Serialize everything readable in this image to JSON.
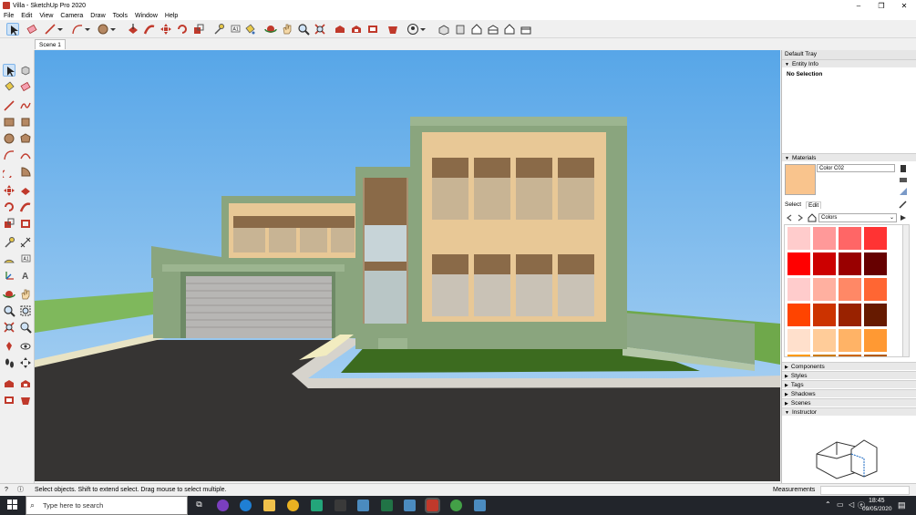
{
  "window": {
    "title": "Villa - SketchUp Pro 2020",
    "minimize": "–",
    "maximize": "❐",
    "close": "✕"
  },
  "menu": [
    "File",
    "Edit",
    "View",
    "Camera",
    "Draw",
    "Tools",
    "Window",
    "Help"
  ],
  "scene_tab": "Scene 1",
  "toolbar_icons": [
    "select-icon",
    "eraser-icon",
    "line-icon",
    "line-dropdown-icon",
    "arc-icon",
    "arc-dropdown-icon",
    "shape-icon",
    "shape-dropdown-icon",
    "push-pull-icon",
    "follow-me-icon",
    "move-icon",
    "rotate-icon",
    "scale-icon",
    "tape-measure-icon",
    "text-icon",
    "paint-bucket-icon",
    "orbit-icon",
    "pan-icon",
    "zoom-icon",
    "zoom-extents-icon",
    "warehouse-icon",
    "extension-warehouse-icon",
    "layout-icon",
    "extension-manager-icon",
    "account-icon",
    "iso-view-icon",
    "top-view-icon",
    "front-view-icon",
    "right-view-icon",
    "back-view-icon",
    "left-view-icon"
  ],
  "tray": {
    "title": "Default Tray",
    "entity_info": {
      "label": "Entity Info",
      "selection": "No Selection"
    },
    "materials": {
      "label": "Materials",
      "current_name": "Color C02",
      "current_color": "#f9c48d",
      "tab_select": "Select",
      "tab_edit": "Edit",
      "library": "Colors",
      "swatches": [
        "#ffcccc",
        "#ff9999",
        "#ff6666",
        "#ff3333",
        "#ff0000",
        "#cc0000",
        "#990000",
        "#660000",
        "#ffcccc",
        "#ffb0a0",
        "#ff8866",
        "#ff6633",
        "#ff4400",
        "#cc3300",
        "#992200",
        "#661a00",
        "#ffe0cc",
        "#ffcc99",
        "#ffb366",
        "#ff9933",
        "#ff9900",
        "#cc7a00",
        "#cc6600",
        "#b35900"
      ]
    },
    "panels": [
      "Components",
      "Styles",
      "Tags",
      "Shadows",
      "Scenes",
      "Instructor"
    ]
  },
  "status": {
    "hint": "Select objects. Shift to extend select. Drag mouse to select multiple.",
    "measurements_label": "Measurements",
    "measurements_value": ""
  },
  "taskbar": {
    "search_placeholder": "Type here to search",
    "time": "18:45",
    "date": "09/05/2020"
  }
}
